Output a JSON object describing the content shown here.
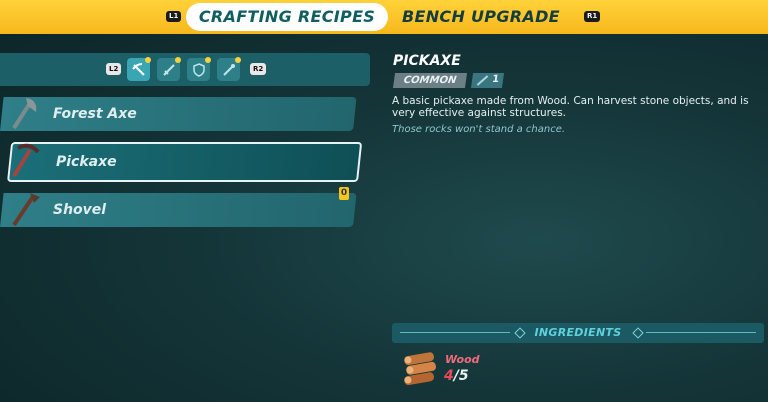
{
  "header": {
    "left_hint": "L1",
    "right_hint": "R1",
    "tabs": [
      {
        "label": "CRAFTING RECIPES",
        "active": true
      },
      {
        "label": "BENCH UPGRADE",
        "active": false
      }
    ],
    "accent_color": "#f6b81c"
  },
  "filters": {
    "left_hint": "L2",
    "right_hint": "R2",
    "buttons": [
      {
        "icon": "pickaxe-icon",
        "selected": true
      },
      {
        "icon": "sword-icon",
        "selected": false
      },
      {
        "icon": "shield-icon",
        "selected": false
      },
      {
        "icon": "wand-icon",
        "selected": false
      }
    ]
  },
  "recipes": [
    {
      "label": "Forest Axe",
      "icon": "axe-icon"
    },
    {
      "label": "Pickaxe",
      "icon": "pickaxe-icon",
      "selected": true
    },
    {
      "label": "Shovel",
      "icon": "shovel-icon",
      "badge": "0"
    }
  ],
  "detail": {
    "title": "PICKAXE",
    "rarity": "COMMON",
    "level": "1",
    "description": "A basic pickaxe made from Wood. Can harvest stone objects, and is very effective against structures.",
    "flavor": "Those rocks won't stand a chance."
  },
  "ingredients": {
    "title": "INGREDIENTS",
    "items": [
      {
        "name": "Wood",
        "have": "4",
        "need": "/5",
        "icon": "wood-logs-icon"
      }
    ]
  }
}
